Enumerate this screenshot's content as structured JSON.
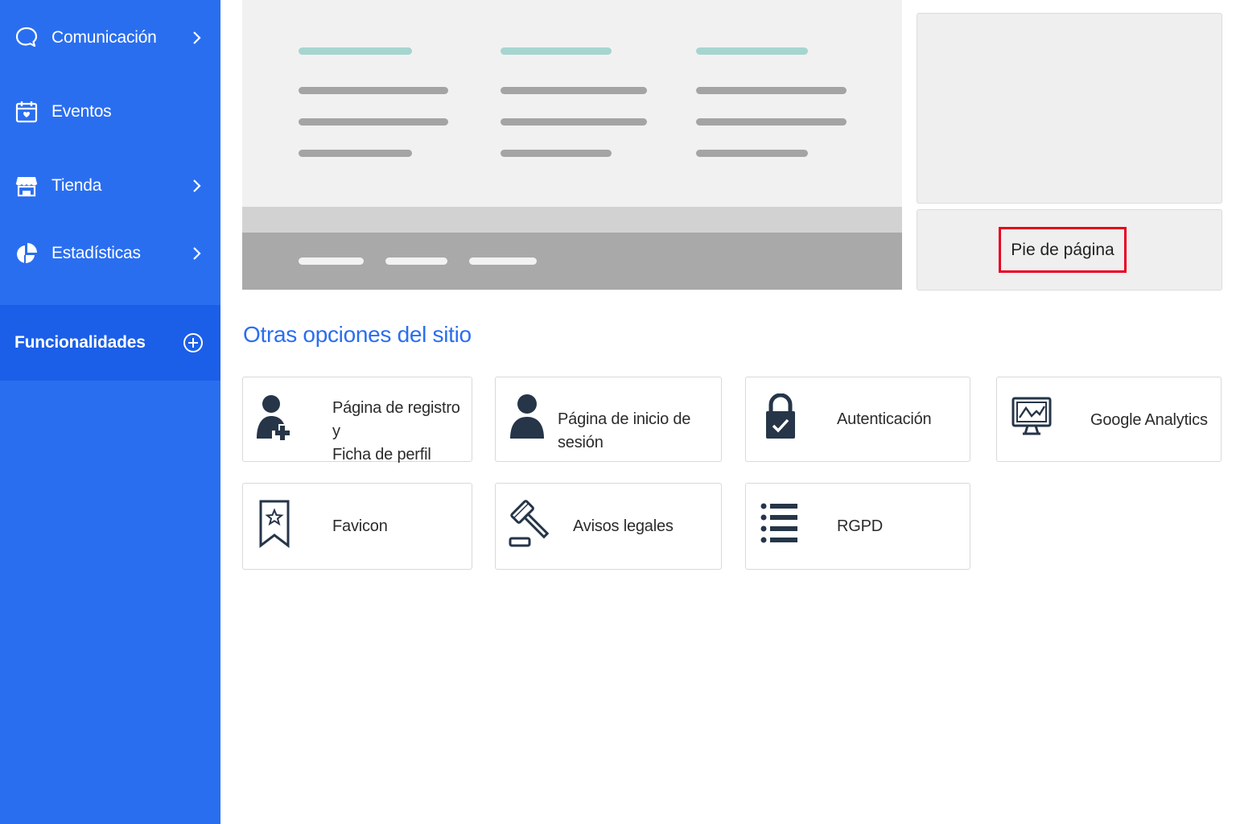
{
  "sidebar": {
    "items": [
      {
        "label": "Comunicación",
        "icon": "chat-bubble-icon",
        "has_chevron": true
      },
      {
        "label": "Eventos",
        "icon": "calendar-icon",
        "has_chevron": false
      },
      {
        "label": "Tienda",
        "icon": "store-icon",
        "has_chevron": true
      },
      {
        "label": "Estadísticas",
        "icon": "pie-chart-icon",
        "has_chevron": true
      }
    ],
    "active": {
      "label": "Funcionalidades",
      "icon": "plus-circle-icon"
    }
  },
  "preview": {
    "footer_label": "Pie de página"
  },
  "section": {
    "title": "Otras opciones del sitio"
  },
  "cards": [
    {
      "label_line1": "Página de registro y",
      "label_line2": "Ficha de perfil",
      "icon": "user-add-icon"
    },
    {
      "label": "Página de inicio de sesión",
      "icon": "user-icon"
    },
    {
      "label": "Autenticación",
      "icon": "lock-icon"
    },
    {
      "label": "Google Analytics",
      "icon": "analytics-monitor-icon"
    },
    {
      "label": "Favicon",
      "icon": "bookmark-star-icon"
    },
    {
      "label": "Avisos legales",
      "icon": "gavel-icon"
    },
    {
      "label": "RGPD",
      "icon": "list-icon"
    }
  ],
  "colors": {
    "sidebar": "#2a6ef0",
    "sidebar_active": "#1b5ee8",
    "accent": "#2a6ef0",
    "highlight_border": "#e8001c",
    "icon_dark": "#263548"
  }
}
